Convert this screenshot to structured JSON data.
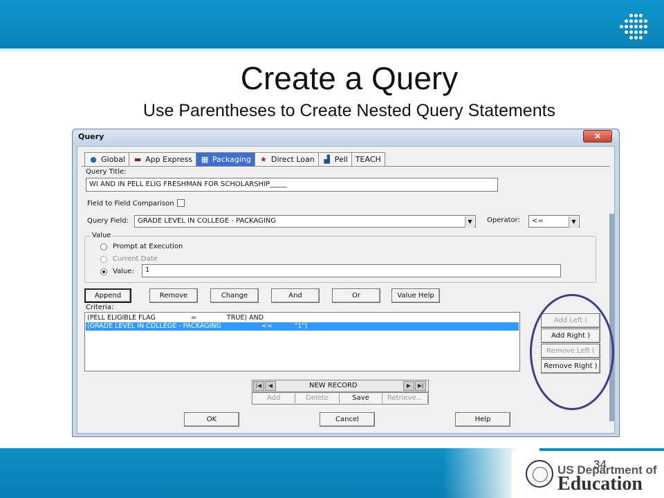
{
  "slide": {
    "title": "Create a Query",
    "subtitle": "Use Parentheses to Create Nested Query Statements",
    "page_number": "34",
    "footer_logo_line1": "US Department of",
    "footer_logo_line2": "Education"
  },
  "window": {
    "title": "Query",
    "close_label": "✕"
  },
  "tabs": [
    {
      "label": "Global",
      "icon": "globe-icon",
      "glyph": "🌐"
    },
    {
      "label": "App Express",
      "icon": "app-express-icon",
      "glyph": "▬"
    },
    {
      "label": "Packaging",
      "icon": "packaging-icon",
      "glyph": "▦",
      "active": true
    },
    {
      "label": "Direct Loan",
      "icon": "star-icon",
      "glyph": "★"
    },
    {
      "label": "Pell",
      "icon": "pell-icon",
      "glyph": "▟"
    },
    {
      "label": "TEACH",
      "icon": "",
      "glyph": ""
    }
  ],
  "form": {
    "query_title_label": "Query Title:",
    "query_title_value": "WI AND IN PELL ELIG FRESHMAN FOR SCHOLARSHIP_____",
    "field_compare_label": "Field to Field Comparison",
    "query_field_label": "Query Field:",
    "query_field_value": "GRADE LEVEL IN COLLEGE - PACKAGING",
    "operator_label": "Operator:",
    "operator_value": "<=",
    "value_group_label": "Value",
    "radio_prompt": "Prompt at Execution",
    "radio_current_date": "Current Date",
    "radio_value": "Value:",
    "value_value": "1"
  },
  "action_buttons": {
    "append": "Append",
    "remove": "Remove",
    "change": "Change",
    "and": "And",
    "or": "Or",
    "value_help": "Value Help"
  },
  "criteria": {
    "label": "Criteria:",
    "rows": [
      {
        "field": "(PELL ELIGIBLE FLAG",
        "op": "=",
        "value": "TRUE) AND",
        "selected": false
      },
      {
        "field": "(GRADE LEVEL IN COLLEGE - PACKAGING",
        "op": "<=",
        "value": "\"1\")",
        "selected": true
      }
    ]
  },
  "paren_buttons": {
    "add_left": "Add Left (",
    "add_right": "Add Right )",
    "remove_left": "Remove Left (",
    "remove_right": "Remove Right )"
  },
  "record_nav": {
    "status": "NEW RECORD",
    "first": "|◀",
    "prev": "◀",
    "next": "▶",
    "last": "▶|",
    "add": "Add",
    "delete": "Delete",
    "save": "Save",
    "retrieve": "Retrieve..."
  },
  "footer_buttons": {
    "ok": "OK",
    "cancel": "Cancel",
    "help": "Help"
  },
  "colors": {
    "slide_band": "#0a82b8",
    "active_tab": "#3d6fd1",
    "selection": "#3399ff",
    "annotation_oval": "#3b3b8f"
  }
}
